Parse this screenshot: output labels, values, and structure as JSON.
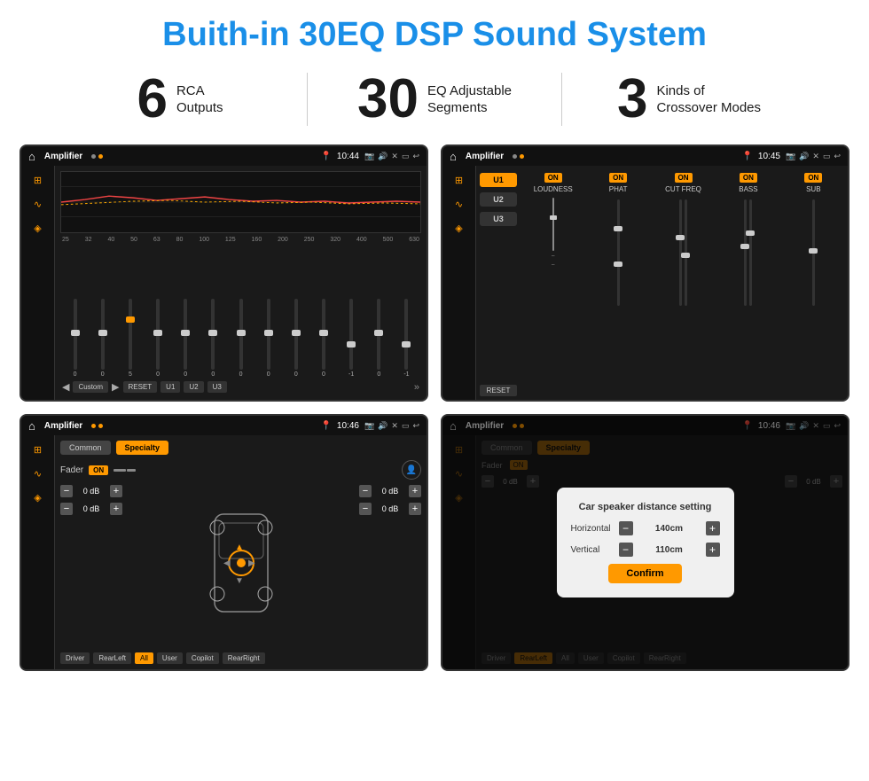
{
  "page": {
    "title": "Buith-in 30EQ DSP Sound System"
  },
  "stats": [
    {
      "number": "6",
      "line1": "RCA",
      "line2": "Outputs"
    },
    {
      "number": "30",
      "line1": "EQ Adjustable",
      "line2": "Segments"
    },
    {
      "number": "3",
      "line1": "Kinds of",
      "line2": "Crossover Modes"
    }
  ],
  "screens": {
    "screen1": {
      "statusBar": {
        "title": "Amplifier",
        "time": "10:44"
      },
      "freqLabels": [
        "25",
        "32",
        "40",
        "50",
        "63",
        "80",
        "100",
        "125",
        "160",
        "200",
        "250",
        "320",
        "400",
        "500",
        "630"
      ],
      "sliderValues": [
        "0",
        "0",
        "0",
        "5",
        "0",
        "0",
        "0",
        "0",
        "0",
        "0",
        "0",
        "-1",
        "0",
        "-1"
      ],
      "buttons": [
        "Custom",
        "RESET",
        "U1",
        "U2",
        "U3"
      ]
    },
    "screen2": {
      "statusBar": {
        "title": "Amplifier",
        "time": "10:45"
      },
      "presets": [
        "U1",
        "U2",
        "U3"
      ],
      "controls": [
        "LOUDNESS",
        "PHAT",
        "CUT FREQ",
        "BASS",
        "SUB"
      ],
      "resetBtn": "RESET"
    },
    "screen3": {
      "statusBar": {
        "title": "Amplifier",
        "time": "10:46"
      },
      "tabs": [
        "Common",
        "Specialty"
      ],
      "faderLabel": "Fader",
      "positions": [
        "Driver",
        "RearLeft",
        "All",
        "User",
        "Copilot",
        "RearRight"
      ],
      "dbValues": [
        "0 dB",
        "0 dB",
        "0 dB",
        "0 dB"
      ]
    },
    "screen4": {
      "statusBar": {
        "title": "Amplifier",
        "time": "10:46"
      },
      "tabs": [
        "Common",
        "Specialty"
      ],
      "dialog": {
        "title": "Car speaker distance setting",
        "horizontal": {
          "label": "Horizontal",
          "value": "140cm"
        },
        "vertical": {
          "label": "Vertical",
          "value": "110cm"
        },
        "confirmBtn": "Confirm"
      },
      "positions": [
        "Driver",
        "RearLeft",
        "All",
        "User",
        "Copilot",
        "RearRight"
      ],
      "dbValues": [
        "0 dB",
        "0 dB"
      ]
    }
  }
}
